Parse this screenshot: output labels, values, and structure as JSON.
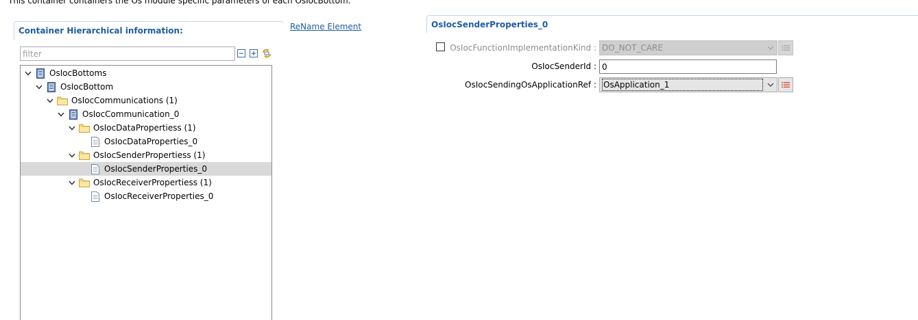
{
  "description": "This container containers the Os module specific parameters of each OsIocBottom.",
  "left_panel": {
    "title": "Container Hierarchical information:",
    "rename_link": "ReName Element",
    "filter": {
      "placeholder": "filter",
      "value": ""
    },
    "toolbar": {
      "collapse_icon": "collapse-all-icon",
      "expand_icon": "expand-all-icon",
      "sync_icon": "link-sync-icon"
    },
    "tree": [
      {
        "label": "OsIocBottoms",
        "level": 0,
        "icon": "module-icon",
        "expanded": true,
        "selected": false
      },
      {
        "label": "OsIocBottom",
        "level": 1,
        "icon": "module-icon",
        "expanded": true,
        "selected": false
      },
      {
        "label": "OsIocCommunications (1)",
        "level": 2,
        "icon": "folder-icon",
        "expanded": true,
        "selected": false
      },
      {
        "label": "OsIocCommunication_0",
        "level": 3,
        "icon": "module-icon",
        "expanded": true,
        "selected": false
      },
      {
        "label": "OsIocDataPropertiess (1)",
        "level": 4,
        "icon": "folder-icon",
        "expanded": true,
        "selected": false
      },
      {
        "label": "OsIocDataProperties_0",
        "level": 5,
        "icon": "document-icon",
        "expanded": false,
        "selected": false
      },
      {
        "label": "OsIocSenderPropertiess (1)",
        "level": 4,
        "icon": "folder-icon",
        "expanded": true,
        "selected": false
      },
      {
        "label": "OsIocSenderProperties_0",
        "level": 5,
        "icon": "document-icon",
        "expanded": false,
        "selected": true
      },
      {
        "label": "OsIocReceiverPropertiess (1)",
        "level": 4,
        "icon": "folder-icon",
        "expanded": true,
        "selected": false
      },
      {
        "label": "OsIocReceiverProperties_0",
        "level": 5,
        "icon": "document-icon",
        "expanded": false,
        "selected": false
      }
    ]
  },
  "right_panel": {
    "title": "OsIocSenderProperties_0",
    "fields": {
      "function_impl_kind": {
        "label": "OsIocFunctionImplementationKind :",
        "value": "DO_NOT_CARE",
        "enabled": false,
        "checked": false
      },
      "sender_id": {
        "label": "OsIocSenderId :",
        "value": "0"
      },
      "sending_app_ref": {
        "label": "OsIocSendingOsApplicationRef :",
        "value": "OsApplication_1"
      }
    }
  },
  "colors": {
    "accent": "#1f5da2",
    "selection": "#d9d9d9",
    "disabled_bg": "#cfcfcf",
    "ref_icon_red": "#d84a3a"
  }
}
